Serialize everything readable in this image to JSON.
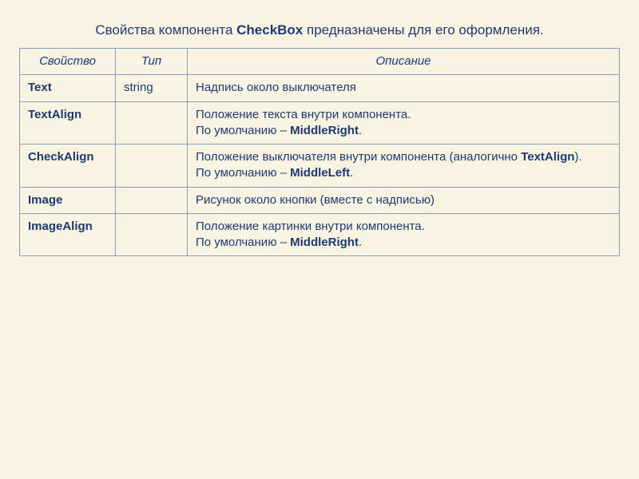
{
  "title": {
    "prefix": "Свойства компонента ",
    "bold": "CheckBox",
    "suffix": " предназначены для его оформления."
  },
  "table": {
    "headers": {
      "property": "Свойство",
      "type": "Тип",
      "description": "Описание"
    },
    "rows": [
      {
        "property": "Text",
        "type": "string",
        "description_parts": [
          {
            "t": "Надпись около выключателя"
          }
        ]
      },
      {
        "property": "TextAlign",
        "type": "",
        "description_parts": [
          {
            "t": "Положение текста внутри компонента."
          },
          {
            "br": true
          },
          {
            "t": "По умолчанию – "
          },
          {
            "t": "MiddleRight",
            "b": true
          },
          {
            "t": "."
          }
        ]
      },
      {
        "property": "CheckAlign",
        "type": "",
        "description_parts": [
          {
            "t": "Положение выключателя внутри компонента (аналогично "
          },
          {
            "t": "TextAlign",
            "b": true
          },
          {
            "t": ")."
          },
          {
            "br": true
          },
          {
            "t": "По умолчанию – "
          },
          {
            "t": "MiddleLeft",
            "b": true
          },
          {
            "t": "."
          }
        ]
      },
      {
        "property": "Image",
        "type": "",
        "description_parts": [
          {
            "t": "Рисунок около кнопки (вместе с  надписью)"
          }
        ]
      },
      {
        "property": "ImageAlign",
        "type": "",
        "description_parts": [
          {
            "t": "Положение картинки внутри компонента."
          },
          {
            "br": true
          },
          {
            "t": "По умолчанию – "
          },
          {
            "t": "MiddleRight",
            "b": true
          },
          {
            "t": "."
          }
        ]
      }
    ]
  },
  "chart_data": {
    "type": "table",
    "title": "Свойства компонента CheckBox предназначены для его оформления.",
    "columns": [
      "Свойство",
      "Тип",
      "Описание"
    ],
    "rows": [
      [
        "Text",
        "string",
        "Надпись около выключателя"
      ],
      [
        "TextAlign",
        "",
        "Положение текста внутри компонента. По умолчанию – MiddleRight."
      ],
      [
        "CheckAlign",
        "",
        "Положение выключателя внутри компонента (аналогично TextAlign). По умолчанию – MiddleLeft."
      ],
      [
        "Image",
        "",
        "Рисунок около кнопки (вместе с  надписью)"
      ],
      [
        "ImageAlign",
        "",
        "Положение картинки внутри компонента. По умолчанию – MiddleRight."
      ]
    ]
  }
}
